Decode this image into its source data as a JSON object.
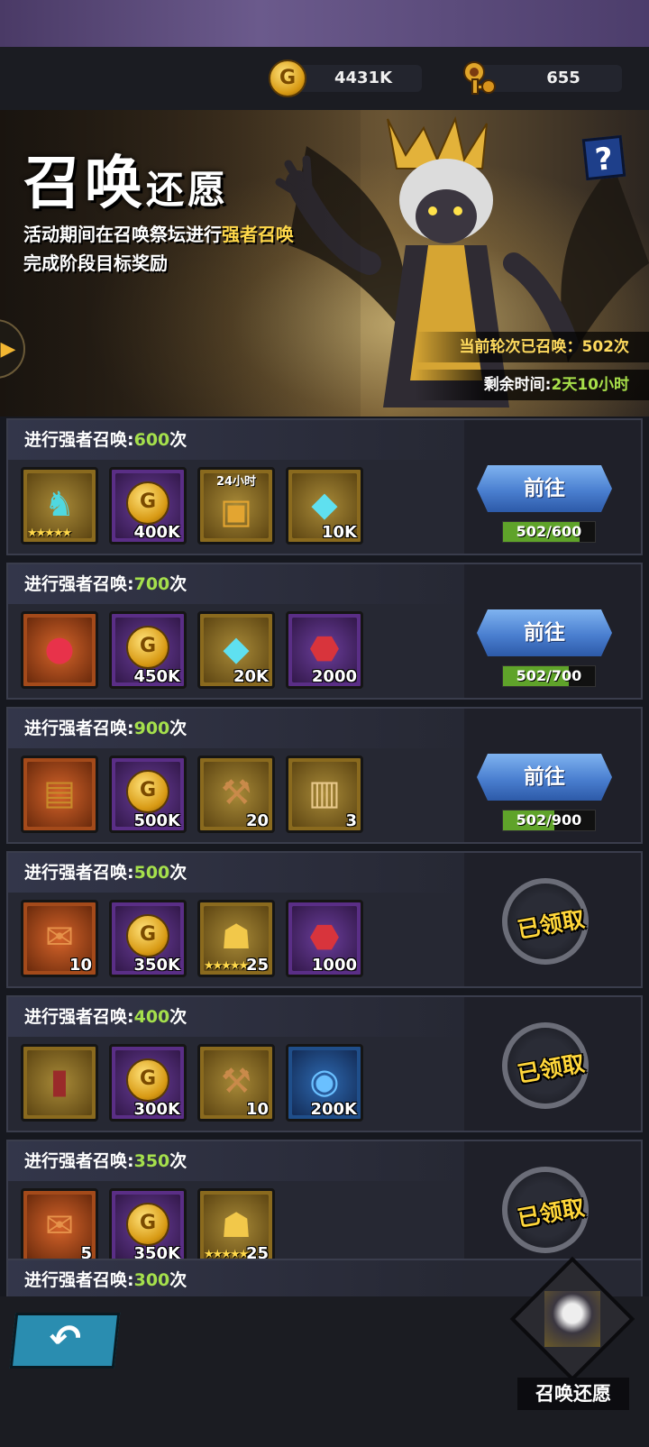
{
  "resources": {
    "gold": "4431K",
    "keys": "655"
  },
  "banner": {
    "title_main": "召唤",
    "title_small": "还愿",
    "desc_line1_pre": "活动期间在召唤祭坛进行",
    "desc_line1_hl": "强者召唤",
    "desc_line2": "完成阶段目标奖励",
    "round_label": "当前轮次已召唤：",
    "round_value": "502次",
    "time_label": "剩余时间:",
    "time_value": "2天10小时",
    "help": "?"
  },
  "task_prefix": "进行强者召唤:",
  "task_suffix": "次",
  "go_label": "前往",
  "claimed_label": "已领取",
  "tasks": [
    {
      "target": "600",
      "status": "go",
      "progress_text": "502/600",
      "progress_fraction": 0.837,
      "items": [
        {
          "type": "hero-card",
          "frame": "gold",
          "qty": "",
          "stars": "★★★★★"
        },
        {
          "type": "gold-coin",
          "frame": "purple",
          "qty": "400K"
        },
        {
          "type": "treasure-chest",
          "frame": "gold",
          "qty": "",
          "top": "24小时"
        },
        {
          "type": "blue-crystal",
          "frame": "gold",
          "qty": "10K"
        }
      ]
    },
    {
      "target": "700",
      "status": "go",
      "progress_text": "502/700",
      "progress_fraction": 0.717,
      "items": [
        {
          "type": "ruby-amulet",
          "frame": "orange",
          "qty": ""
        },
        {
          "type": "gold-coin",
          "frame": "purple",
          "qty": "450K"
        },
        {
          "type": "blue-crystal",
          "frame": "gold",
          "qty": "20K"
        },
        {
          "type": "red-stone",
          "frame": "purple",
          "qty": "2000"
        }
      ]
    },
    {
      "target": "900",
      "status": "go",
      "progress_text": "502/900",
      "progress_fraction": 0.558,
      "items": [
        {
          "type": "gem-chest",
          "frame": "orange",
          "qty": ""
        },
        {
          "type": "gold-coin",
          "frame": "purple",
          "qty": "500K"
        },
        {
          "type": "hammer",
          "frame": "gold",
          "qty": "20"
        },
        {
          "type": "open-chest",
          "frame": "gold",
          "qty": "3"
        }
      ]
    },
    {
      "target": "500",
      "status": "claimed",
      "items": [
        {
          "type": "scroll",
          "frame": "orange",
          "qty": "10"
        },
        {
          "type": "gold-coin",
          "frame": "purple",
          "qty": "350K"
        },
        {
          "type": "hero-shard",
          "frame": "gold",
          "qty": "25",
          "stars": "★★★★★"
        },
        {
          "type": "red-stone",
          "frame": "purple",
          "qty": "1000"
        }
      ]
    },
    {
      "target": "400",
      "status": "claimed",
      "items": [
        {
          "type": "tarot-card",
          "frame": "gold",
          "qty": ""
        },
        {
          "type": "gold-coin",
          "frame": "purple",
          "qty": "300K"
        },
        {
          "type": "hammer",
          "frame": "gold",
          "qty": "10"
        },
        {
          "type": "blue-orb",
          "frame": "blue",
          "qty": "200K"
        }
      ]
    },
    {
      "target": "350",
      "status": "claimed",
      "items": [
        {
          "type": "scroll",
          "frame": "orange",
          "qty": "5"
        },
        {
          "type": "gold-coin",
          "frame": "purple",
          "qty": "350K"
        },
        {
          "type": "hero-shard",
          "frame": "gold",
          "qty": "25",
          "stars": "★★★★★"
        }
      ]
    }
  ],
  "partial_task": {
    "target": "300"
  },
  "bottom": {
    "back": "↶",
    "portrait_label": "召唤还愿"
  }
}
